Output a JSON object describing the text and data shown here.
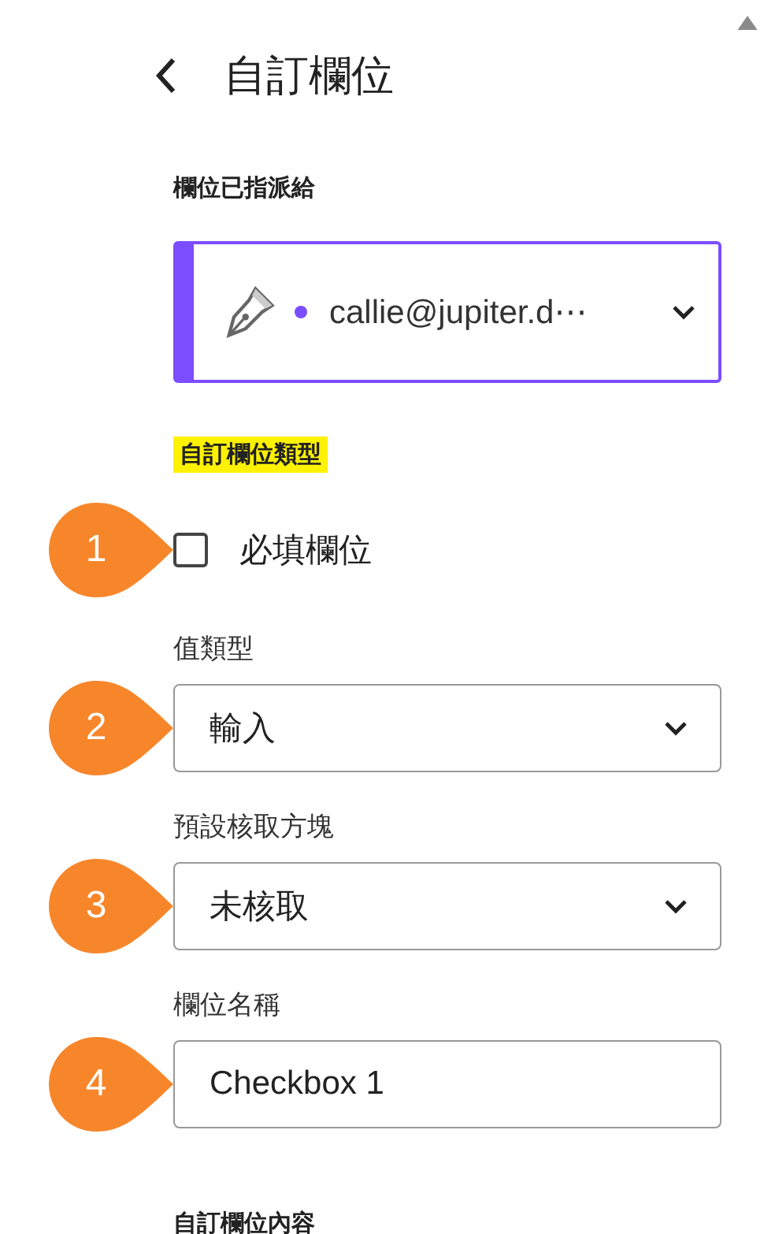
{
  "header": {
    "title": "自訂欄位"
  },
  "assignee": {
    "label": "欄位已指派給",
    "value": "callie@jupiter.d⋯"
  },
  "section": {
    "title": "自訂欄位類型",
    "highlighted": true
  },
  "fields": [
    {
      "kind": "checkbox",
      "callout": "1",
      "label": "必填欄位",
      "checked": false
    },
    {
      "kind": "select",
      "callout": "2",
      "label": "值類型",
      "value": "輸入"
    },
    {
      "kind": "select",
      "callout": "3",
      "label": "預設核取方塊",
      "value": "未核取"
    },
    {
      "kind": "text",
      "callout": "4",
      "label": "欄位名稱",
      "value": "Checkbox 1"
    }
  ],
  "footer_section": {
    "title": "自訂欄位內容"
  }
}
